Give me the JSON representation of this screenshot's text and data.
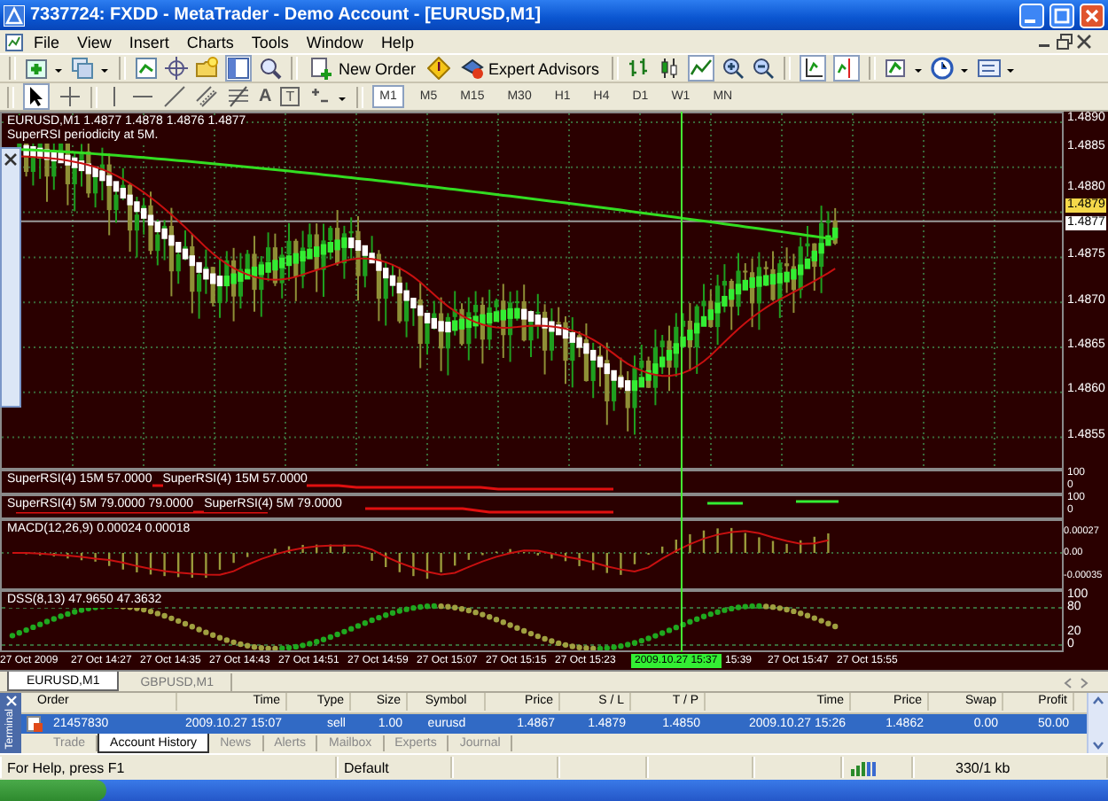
{
  "window": {
    "title": "7337724: FXDD - MetaTrader - Demo Account - [EURUSD,M1]"
  },
  "menu": [
    "File",
    "View",
    "Insert",
    "Charts",
    "Tools",
    "Window",
    "Help"
  ],
  "toolbar": {
    "buttons": [
      "New Order",
      "Expert Advisors"
    ]
  },
  "drawing_tools": {
    "text_tools": [
      "A",
      "T"
    ]
  },
  "timeframes": [
    {
      "label": "M1",
      "selected": true
    },
    {
      "label": "M5",
      "selected": false
    },
    {
      "label": "M15",
      "selected": false
    },
    {
      "label": "M30",
      "selected": false
    },
    {
      "label": "H1",
      "selected": false
    },
    {
      "label": "H4",
      "selected": false
    },
    {
      "label": "D1",
      "selected": false
    },
    {
      "label": "W1",
      "selected": false
    },
    {
      "label": "MN",
      "selected": false
    }
  ],
  "chart": {
    "header": "EURUSD,M1  1.4877 1.4878 1.4876 1.4877",
    "note": "SuperRSI periodicity at 5M.",
    "price_scale": [
      "1.4890",
      "1.4885",
      "1.4880",
      "1.4875",
      "1.4870",
      "1.4865",
      "1.4860",
      "1.4855"
    ],
    "bid_label": "1.4879",
    "last_label": "1.4877",
    "indicators": [
      {
        "kind": "rsi",
        "labels": [
          "SuperRSI(4) 15M 57.0000",
          "SuperRSI(4) 15M 57.0000"
        ],
        "scale": [
          "100",
          "0"
        ]
      },
      {
        "kind": "rsi2",
        "labels": [
          "SuperRSI(4) 5M 79.0000 79.0000",
          "SuperRSI(4) 5M 79.0000"
        ],
        "scale": [
          "100",
          "0"
        ]
      },
      {
        "kind": "macd",
        "labels": [
          "MACD(12,26,9) 0.00024 0.00018"
        ],
        "scale": [
          "0.00027",
          "0.00",
          "-0.00035"
        ]
      },
      {
        "kind": "dss",
        "labels": [
          "DSS(8,13) 47.9650 47.3632"
        ],
        "scale": [
          "100",
          "80",
          "20",
          "0"
        ]
      }
    ],
    "time_labels": [
      "27 Oct 2009",
      "27 Oct 14:27",
      "27 Oct 14:35",
      "27 Oct 14:43",
      "27 Oct 14:51",
      "27 Oct 14:59",
      "27 Oct 15:07",
      "27 Oct 15:15",
      "27 Oct 15:23",
      "15:39",
      "27 Oct 15:47",
      "27 Oct 15:55"
    ],
    "cursor_time": "2009.10.27 15:37"
  },
  "chart_tabs": [
    {
      "label": "EURUSD,M1",
      "selected": true
    },
    {
      "label": "GBPUSD,M1",
      "selected": false
    }
  ],
  "terminal": {
    "title": "Terminal",
    "columns": [
      "Order",
      "Time",
      "Type",
      "Size",
      "Symbol",
      "Price",
      "S / L",
      "T / P",
      "Time",
      "Price",
      "Swap",
      "Profit"
    ],
    "rows": [
      {
        "selected": true,
        "cells": [
          "21457830",
          "2009.10.27 15:07",
          "sell",
          "1.00",
          "eurusd",
          "1.4867",
          "1.4879",
          "1.4850",
          "2009.10.27 15:26",
          "1.4862",
          "0.00",
          "50.00"
        ]
      }
    ],
    "tabs": [
      {
        "label": "Trade",
        "selected": false
      },
      {
        "label": "Account History",
        "selected": true
      },
      {
        "label": "News",
        "selected": false
      },
      {
        "label": "Alerts",
        "selected": false
      },
      {
        "label": "Mailbox",
        "selected": false
      },
      {
        "label": "Experts",
        "selected": false
      },
      {
        "label": "Journal",
        "selected": false
      }
    ]
  },
  "status_bar": {
    "help": "For Help, press F1",
    "profile": "Default",
    "traffic": "330/1 kb"
  }
}
